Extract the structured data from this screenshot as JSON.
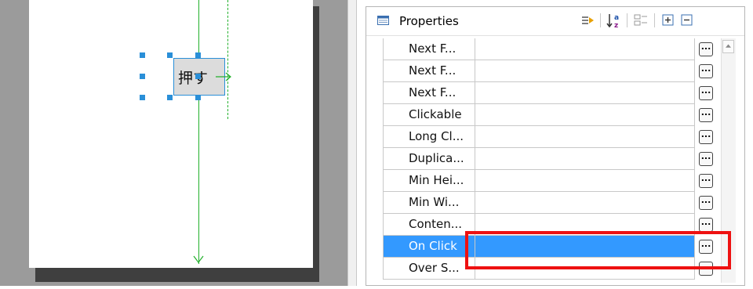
{
  "canvas": {
    "button_text": "押す"
  },
  "properties": {
    "title": "Properties",
    "toolbar_icons": [
      "show-advanced-icon",
      "sort-alpha-icon",
      "categories-icon",
      "expand-all-icon",
      "collapse-all-icon"
    ],
    "ellipsis": "...",
    "rows": [
      {
        "label": "Next F...",
        "value": ""
      },
      {
        "label": "Next F...",
        "value": ""
      },
      {
        "label": "Next F...",
        "value": ""
      },
      {
        "label": "Clickable",
        "value": ""
      },
      {
        "label": "Long Cl...",
        "value": ""
      },
      {
        "label": "Duplica...",
        "value": ""
      },
      {
        "label": "Min Hei...",
        "value": ""
      },
      {
        "label": "Min Wi...",
        "value": ""
      },
      {
        "label": "Conten...",
        "value": ""
      },
      {
        "label": "On Click",
        "value": "",
        "selected": true
      },
      {
        "label": "Over S...",
        "value": ""
      }
    ]
  },
  "colors": {
    "selection": "#3399ff",
    "highlight_box": "#ee1111",
    "guide_line": "#22b02b",
    "handle": "#2a8fd8"
  }
}
